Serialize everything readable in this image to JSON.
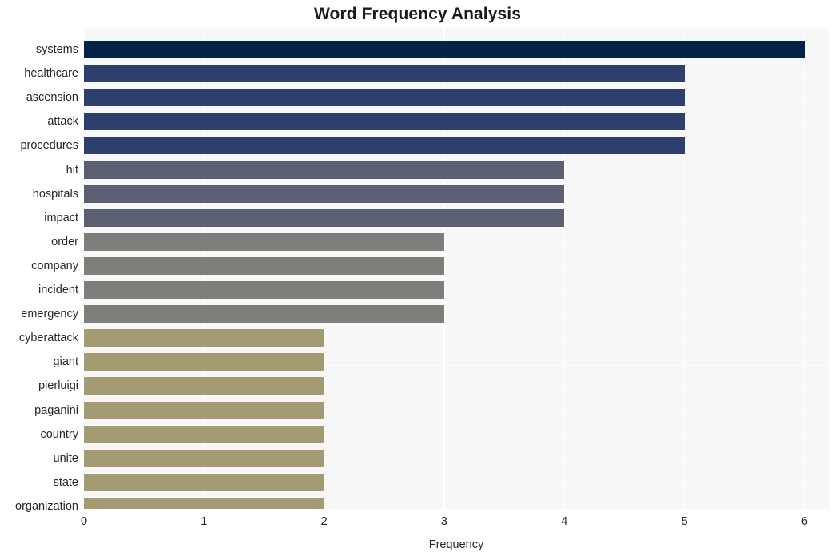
{
  "chart_data": {
    "type": "bar",
    "orientation": "horizontal",
    "title": "Word Frequency Analysis",
    "xlabel": "Frequency",
    "ylabel": "",
    "xlim": [
      0,
      6.2
    ],
    "xticks": [
      0,
      1,
      2,
      3,
      4,
      5,
      6
    ],
    "xtick_labels": [
      "0",
      "1",
      "2",
      "3",
      "4",
      "5",
      "6"
    ],
    "grid": true,
    "grid_axis": "x",
    "legend": false,
    "background": "#f7f7f7",
    "categories": [
      "systems",
      "healthcare",
      "ascension",
      "attack",
      "procedures",
      "hit",
      "hospitals",
      "impact",
      "order",
      "company",
      "incident",
      "emergency",
      "cyberattack",
      "giant",
      "pierluigi",
      "paganini",
      "country",
      "unite",
      "state",
      "organization"
    ],
    "values": [
      6,
      5,
      5,
      5,
      5,
      4,
      4,
      4,
      3,
      3,
      3,
      3,
      2,
      2,
      2,
      2,
      2,
      2,
      2,
      2
    ],
    "bar_colors": [
      "#042349",
      "#2e3f6e",
      "#2e3f6e",
      "#2e3f6e",
      "#2e3f6e",
      "#5a5f74",
      "#5a5f74",
      "#5a5f74",
      "#7d7d79",
      "#7d7d79",
      "#7d7d79",
      "#7d7d79",
      "#a39c73",
      "#a39c73",
      "#a39c73",
      "#a39c73",
      "#a39c73",
      "#a39c73",
      "#a39c73",
      "#a39c73"
    ]
  }
}
